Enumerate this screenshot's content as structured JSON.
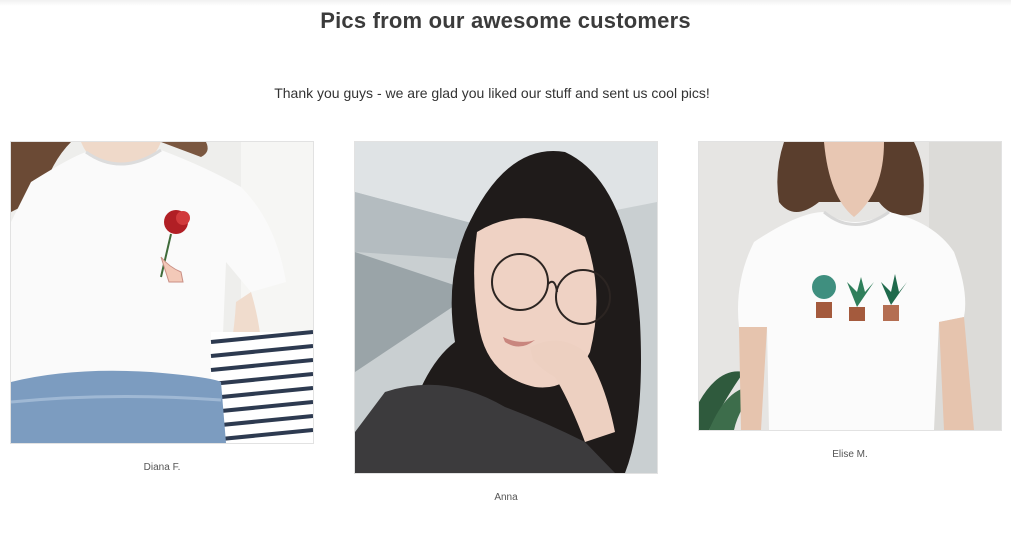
{
  "heading": "Pics from our awesome customers",
  "subheading": "Thank you guys - we are glad you liked our stuff and sent us cool pics!",
  "photos": [
    {
      "name": "Diana F.",
      "image": "rose-embroidered-tshirt-photo"
    },
    {
      "name": "Anna",
      "image": "girl-with-glasses-selfie-photo"
    },
    {
      "name": "Elise M.",
      "image": "cactus-embroidered-tshirt-photo"
    }
  ],
  "colors": {
    "heading": "#3b3b3b",
    "text": "#333333",
    "border": "#e2e2e2"
  }
}
